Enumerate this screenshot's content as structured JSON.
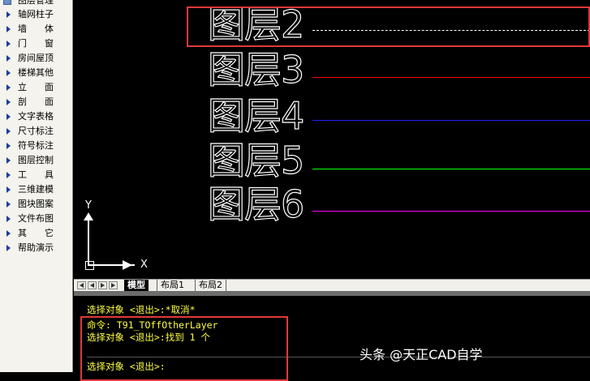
{
  "sidebar": {
    "header": "图层管理",
    "items": [
      "轴网柱子",
      "墙　　体",
      "门　　窗",
      "房间屋顶",
      "楼梯其他",
      "立　　面",
      "剖　　面",
      "文字表格",
      "尺寸标注",
      "符号标注",
      "图层控制",
      "工　　具",
      "三维建模",
      "图块图案",
      "文件布图",
      "其　　它",
      "帮助演示"
    ]
  },
  "canvas": {
    "layers": [
      {
        "label": "图层2",
        "line_color": "#ffffff",
        "line_style": "dashed"
      },
      {
        "label": "图层3",
        "line_color": "#ff0000",
        "line_style": "solid"
      },
      {
        "label": "图层4",
        "line_color": "#2020ff",
        "line_style": "solid"
      },
      {
        "label": "图层5",
        "line_color": "#00ff00",
        "line_style": "solid"
      },
      {
        "label": "图层6",
        "line_color": "#ff00ff",
        "line_style": "solid"
      }
    ],
    "ucs": {
      "y_label": "Y",
      "x_label": "X"
    },
    "highlight_color": "#e0393a"
  },
  "tabs": {
    "model": "模型",
    "layout1": "布局1",
    "layout2": "布局2"
  },
  "command": {
    "lines": [
      "选择对象 <退出>:*取消*",
      "命令: T91_TOffOtherLayer",
      "选择对象 <退出>:找到 1 个",
      "选择对象 <退出>:"
    ],
    "text_color": "#ffff40"
  },
  "watermark": "头条 @天正CAD自学"
}
